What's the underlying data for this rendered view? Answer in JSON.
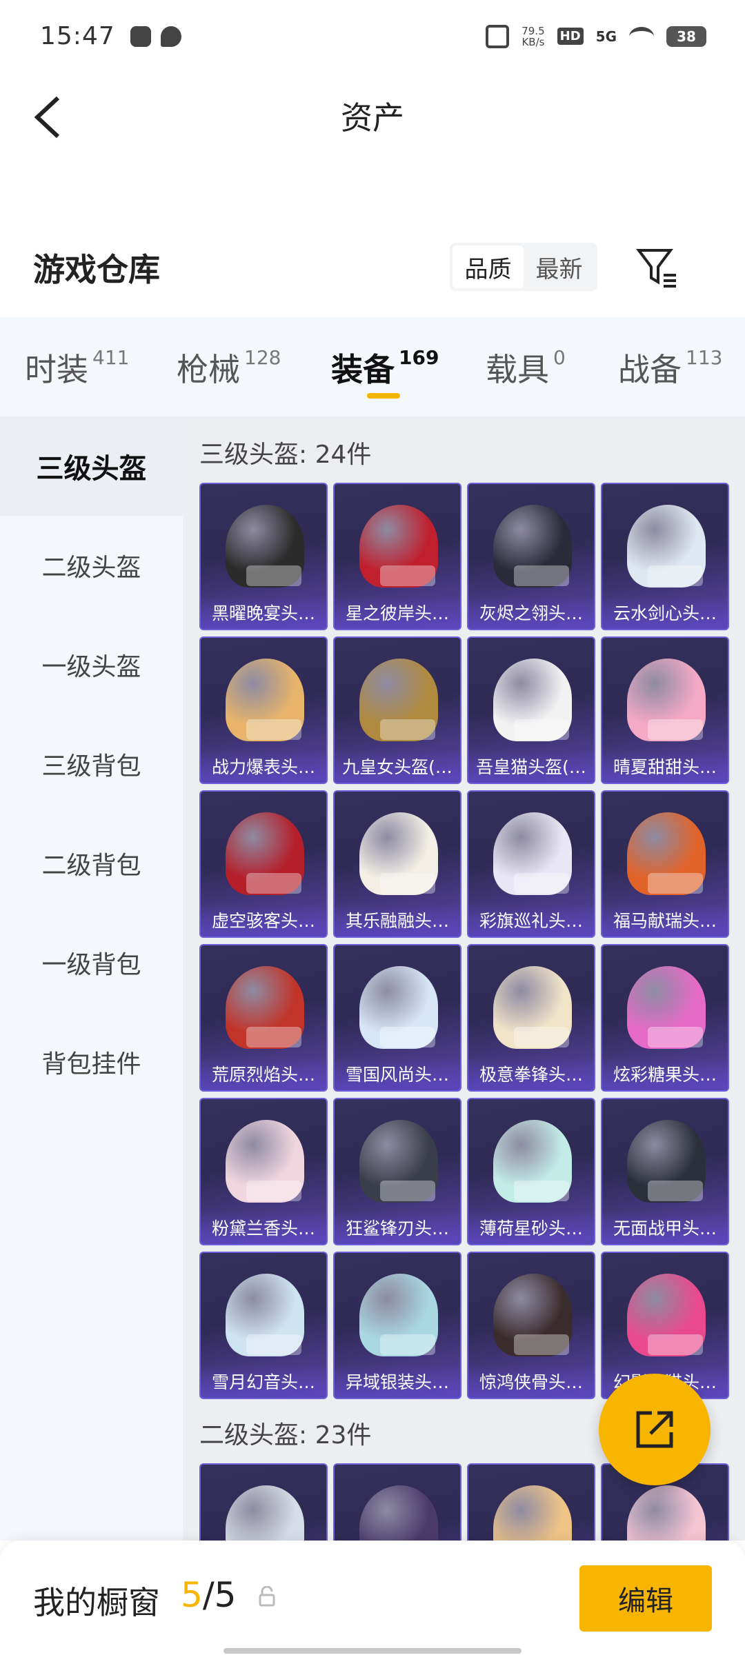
{
  "status_bar": {
    "time": "15:47",
    "net_speed_value": "79.5",
    "net_speed_unit": "KB/s",
    "hd": "HD",
    "signal": "5G",
    "battery": "38"
  },
  "header": {
    "title": "资产"
  },
  "warehouse": {
    "title": "游戏仓库",
    "sort_options": [
      "品质",
      "最新"
    ],
    "sort_selected": "品质"
  },
  "tabs": [
    {
      "label": "时装",
      "count": "411"
    },
    {
      "label": "枪械",
      "count": "128"
    },
    {
      "label": "装备",
      "count": "169"
    },
    {
      "label": "载具",
      "count": "0"
    },
    {
      "label": "战备",
      "count": "113"
    }
  ],
  "active_tab": "装备",
  "sidebar": {
    "items": [
      "三级头盔",
      "二级头盔",
      "一级头盔",
      "三级背包",
      "二级背包",
      "一级背包",
      "背包挂件"
    ],
    "active": "三级头盔"
  },
  "sections": [
    {
      "title": "三级头盔: 24件",
      "items": [
        "黑曜晚宴头…",
        "星之彼岸头…",
        "灰烬之翎头…",
        "云水剑心头…",
        "战力爆表头…",
        "九皇女头盔(…",
        "吾皇猫头盔(…",
        "晴夏甜甜头…",
        "虚空骇客头…",
        "其乐融融头…",
        "彩旗巡礼头…",
        "福马献瑞头…",
        "荒原烈焰头…",
        "雪国风尚头…",
        "极意拳锋头…",
        "炫彩糖果头…",
        "粉黛兰香头…",
        "狂鲨锋刃头…",
        "薄荷星砂头…",
        "无面战甲头…",
        "雪月幻音头…",
        "异域银装头…",
        "惊鸿侠骨头…",
        "幻影…猫头…"
      ],
      "helmet_colors": [
        "#2b2b2b",
        "#c0202e",
        "#2a2a3a",
        "#dfe7f0",
        "#e7b46a",
        "#b08a3e",
        "#f2f2f2",
        "#f4a9c4",
        "#b51f2a",
        "#f3efe6",
        "#e9e7f5",
        "#e0632a",
        "#c2342a",
        "#d6e6f7",
        "#f0e3c8",
        "#e66ac7",
        "#f2d6df",
        "#3a3d4a",
        "#c4ece6",
        "#2b2f3a",
        "#cfe4f2",
        "#a9d7e2",
        "#3a2c2c",
        "#e84a8d"
      ]
    },
    {
      "title": "二级头盔: 23件",
      "items": [
        "",
        "",
        "",
        ""
      ],
      "helmet_colors": [
        "#d7dde6",
        "#4a3a6a",
        "#f0c487",
        "#f5c5d3"
      ]
    }
  ],
  "bottom_bar": {
    "label": "我的橱窗",
    "count_current": "5",
    "count_total": "/5",
    "edit_label": "编辑"
  }
}
